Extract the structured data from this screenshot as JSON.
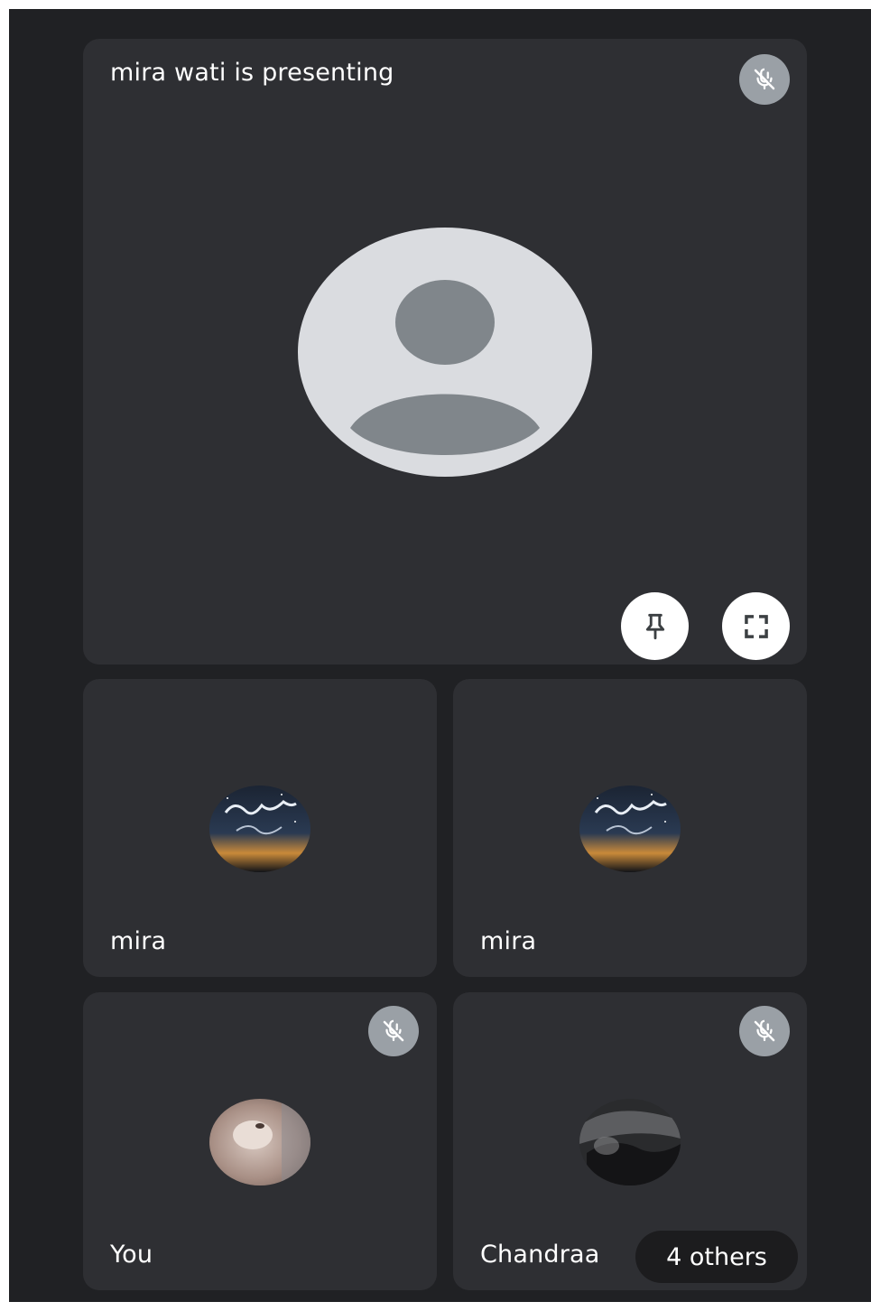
{
  "presenter_tile": {
    "title": "mira wati is presenting",
    "mute_icon": "mic-off-icon",
    "pin_icon": "pin-icon",
    "fullscreen_icon": "fullscreen-icon"
  },
  "participants": [
    {
      "name": "mira",
      "avatar": "arabic-calligraphy-night-sky"
    },
    {
      "name": "mira",
      "avatar": "arabic-calligraphy-night-sky"
    },
    {
      "name": "You",
      "avatar": "blurred-pet-photo",
      "muted": true
    },
    {
      "name": "Chandraa",
      "avatar": "dark-car-photo",
      "muted": true
    }
  ],
  "others_chip": {
    "label": "4 others"
  },
  "colors": {
    "background": "#202124",
    "tile": "#2e2f33",
    "mute_badge": "#9aa0a6",
    "placeholder_avatar": "#dadce0",
    "placeholder_figure": "#80868b"
  }
}
